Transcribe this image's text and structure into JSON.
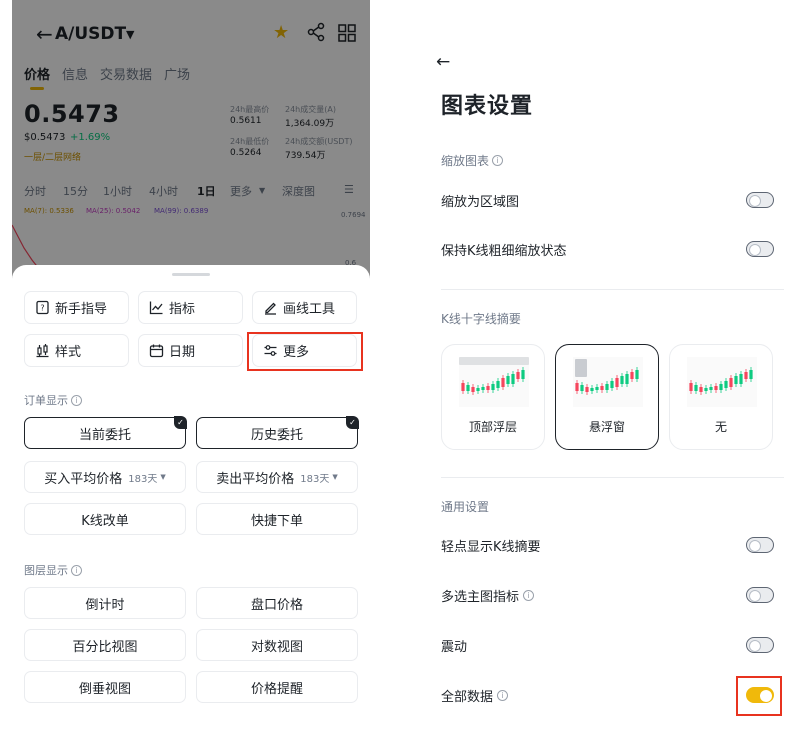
{
  "left": {
    "header": {
      "back_icon": "←",
      "pair": "A/USDT"
    },
    "tabs": [
      {
        "label": "价格"
      },
      {
        "label": "信息"
      },
      {
        "label": "交易数据"
      },
      {
        "label": "广场"
      }
    ],
    "price": {
      "last": "0.5473",
      "usd": "$0.5473",
      "change": "+1.69%",
      "tag": "一层/二层网络"
    },
    "stats": {
      "high_label": "24h最高价",
      "high": "0.5611",
      "vol_a_label": "24h成交量(A)",
      "vol_a": "1,364.09万",
      "low_label": "24h最低价",
      "low": "0.5264",
      "vol_usdt_label": "24h成交额(USDT)",
      "vol_usdt": "739.54万"
    },
    "intervals": [
      "分时",
      "15分",
      "1小时",
      "4小时",
      "1日",
      "更多",
      "深度图"
    ],
    "ma": {
      "ma7": "MA(7): 0.5336",
      "ma25": "MA(25): 0.5042",
      "ma99": "MA(99): 0.6389"
    },
    "axis": {
      "top": "0.7694",
      "mid": "0.6"
    },
    "sheet": {
      "chips": [
        {
          "label": "新手指导",
          "icon": "guide-icon"
        },
        {
          "label": "指标",
          "icon": "indicator-icon"
        },
        {
          "label": "画线工具",
          "icon": "pencil-icon"
        },
        {
          "label": "样式",
          "icon": "style-icon"
        },
        {
          "label": "日期",
          "icon": "calendar-icon"
        },
        {
          "label": "更多",
          "icon": "sliders-icon"
        }
      ],
      "order_section": "订单显示",
      "order_buttons": {
        "open_orders": "当前委托",
        "history_orders": "历史委托",
        "avg_buy": "买入平均价格",
        "avg_buy_days": "183天",
        "avg_sell": "卖出平均价格",
        "avg_sell_days": "183天",
        "modify": "K线改单",
        "quick": "快捷下单"
      },
      "layer_section": "图层显示",
      "layer_buttons": [
        "倒计时",
        "盘口价格",
        "百分比视图",
        "对数视图",
        "倒垂视图",
        "价格提醒"
      ]
    },
    "colors": {
      "accent": "#f0b90b",
      "up": "#0ecb81",
      "down": "#f6465d",
      "highlight": "#e8331f"
    }
  },
  "right": {
    "back_icon": "←",
    "title": "图表设置",
    "zoom_section": "缩放图表",
    "zoom_area": "缩放为区域图",
    "keep_width": "保持K线粗细缩放状态",
    "crosshair_section": "K线十字线摘要",
    "cards": [
      "顶部浮层",
      "悬浮窗",
      "无"
    ],
    "selected_card": 1,
    "general_section": "通用设置",
    "tap_summary": "轻点显示K线摘要",
    "multi_indicator": "多选主图指标",
    "vibrate": "震动",
    "all_data": "全部数据",
    "toggles": {
      "zoom_area": false,
      "keep_width": false,
      "tap_summary": false,
      "multi_indicator": false,
      "vibrate": false,
      "all_data": true
    }
  }
}
